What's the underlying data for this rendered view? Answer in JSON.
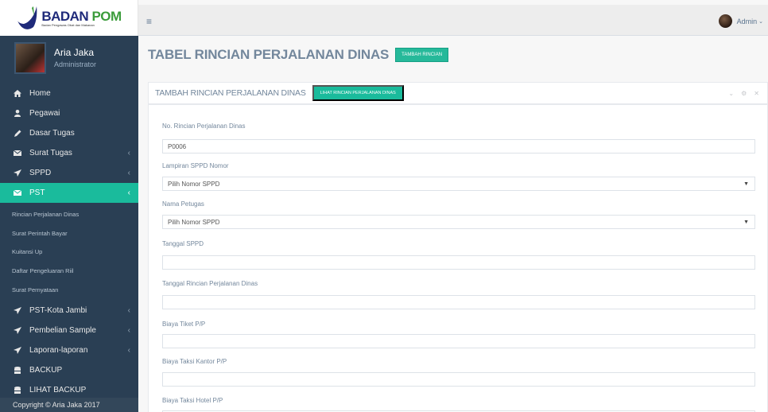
{
  "logo": {
    "title_a": "BADAN ",
    "title_b": "POM",
    "subtitle": "Badan Pengawas Obat dan Makanan"
  },
  "profile": {
    "name": "Aria Jaka",
    "role": "Administrator"
  },
  "menu": {
    "home": "Home",
    "pegawai": "Pegawai",
    "dasar_tugas": "Dasar Tugas",
    "surat_tugas": "Surat Tugas",
    "sppd": "SPPD",
    "pst": "PST",
    "sub": [
      "Rincian Perjalanan Dinas",
      "Surat Perintah Bayar",
      "Kuitansi Up",
      "Daftar Pengeluaran Riil",
      "Surat Pernyataan"
    ],
    "pst_kota": "PST-Kota Jambi",
    "pembelian": "Pembelian Sample",
    "laporan": "Laporan-laporan",
    "backup": "BACKUP",
    "lihat_backup": "LIHAT BACKUP"
  },
  "copyright": "Copyright © Aria Jaka 2017",
  "topnav": {
    "user": "Admin"
  },
  "page": {
    "title": "TABEL RINCIAN PERJALANAN DINAS",
    "add_button": "TAMBAH RINCIAN"
  },
  "panel": {
    "title": "TAMBAH RINCIAN PERJALANAN DINAS",
    "view_button": "LIHAT RINCIAN PERJALANAN DINAS"
  },
  "form": {
    "no_label": "No. Rincian Perjalanan Dinas",
    "no_value": "P0006",
    "lampiran_label": "Lampiran SPPD Nomor",
    "lampiran_value": "Pilih Nomor SPPD",
    "petugas_label": "Nama Petugas",
    "petugas_value": "Pilih Nomor SPPD",
    "tgl_sppd_label": "Tanggal SPPD",
    "tgl_rincian_label": "Tanggal Rincian Perjalanan Dinas",
    "tiket_label": "Biaya Tiket P/P",
    "taksi_kantor_label": "Biaya Taksi Kantor P/P",
    "taksi_hotel_label": "Biaya Taksi Hotel P/P"
  },
  "icons": {
    "hamburger": "menu-icon",
    "chevron": "chevron-left-icon"
  },
  "colors": {
    "sidebar": "#2a3f54",
    "accent": "#1abb9c",
    "button": "#26b99a"
  }
}
